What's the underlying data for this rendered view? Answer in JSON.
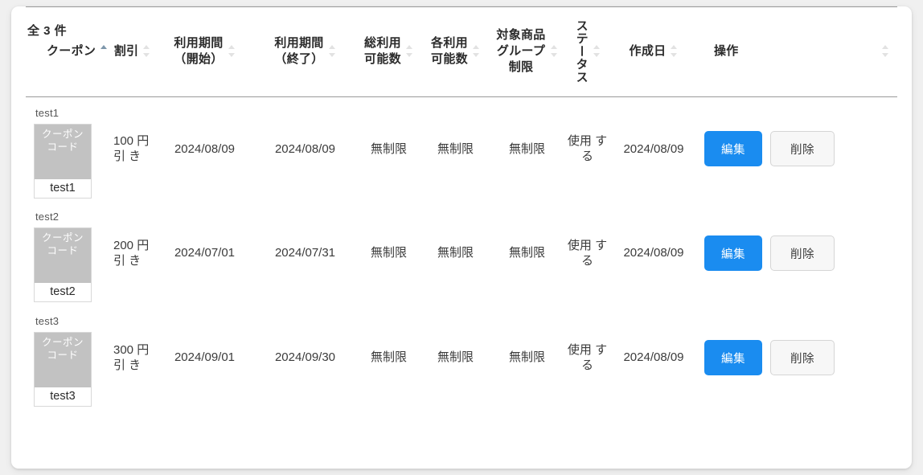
{
  "table": {
    "columns": [
      {
        "label": "クーポン",
        "sort": "asc",
        "key": "coupon"
      },
      {
        "label": "割引",
        "sort": "none",
        "key": "discount"
      },
      {
        "label": "利用期間\n（開始）",
        "sort": "none",
        "key": "period_start"
      },
      {
        "label": "利用期間\n（終了）",
        "sort": "none",
        "key": "period_end"
      },
      {
        "label": "総利用\n可能数",
        "sort": "none",
        "key": "total_uses"
      },
      {
        "label": "各利用\n可能数",
        "sort": "none",
        "key": "per_uses"
      },
      {
        "label": "対象商品\nグループ\n制限",
        "sort": "none",
        "key": "group_limit"
      },
      {
        "label": "ステータス",
        "sort": "none",
        "key": "status",
        "vertical": true
      },
      {
        "label": "作成日",
        "sort": "none",
        "key": "created_at"
      },
      {
        "label": "操作",
        "sort": "none",
        "key": "actions"
      }
    ],
    "rows": [
      {
        "coupon_name": "test1",
        "code_label": "クーポンコード",
        "code_value": "test1",
        "discount": "100\n円引\nき",
        "period_start": "2024/08/09",
        "period_end": "2024/08/09",
        "total_uses": "無制限",
        "per_uses": "無制限",
        "group_limit": "無制限",
        "status": "使用\nする",
        "created_at": "2024/08/09",
        "edit_label": "編集",
        "delete_label": "削除"
      },
      {
        "coupon_name": "test2",
        "code_label": "クーポンコード",
        "code_value": "test2",
        "discount": "200\n円引\nき",
        "period_start": "2024/07/01",
        "period_end": "2024/07/31",
        "total_uses": "無制限",
        "per_uses": "無制限",
        "group_limit": "無制限",
        "status": "使用\nする",
        "created_at": "2024/08/09",
        "edit_label": "編集",
        "delete_label": "削除"
      },
      {
        "coupon_name": "test3",
        "code_label": "クーポンコード",
        "code_value": "test3",
        "discount": "300\n円引\nき",
        "period_start": "2024/09/01",
        "period_end": "2024/09/30",
        "total_uses": "無制限",
        "per_uses": "無制限",
        "group_limit": "無制限",
        "status": "使用\nする",
        "created_at": "2024/08/09",
        "edit_label": "編集",
        "delete_label": "削除"
      }
    ]
  },
  "footer": {
    "count_text": "全 3 件"
  },
  "colors": {
    "accent": "#1a8cf0",
    "sort_active": "#7e97ab",
    "sort_inactive": "#e2e2e2",
    "code_box_fill": "#c2c2c2",
    "rule": "#9a9a9a",
    "page_bg": "#f0f0f0",
    "card_bg": "#ffffff"
  }
}
